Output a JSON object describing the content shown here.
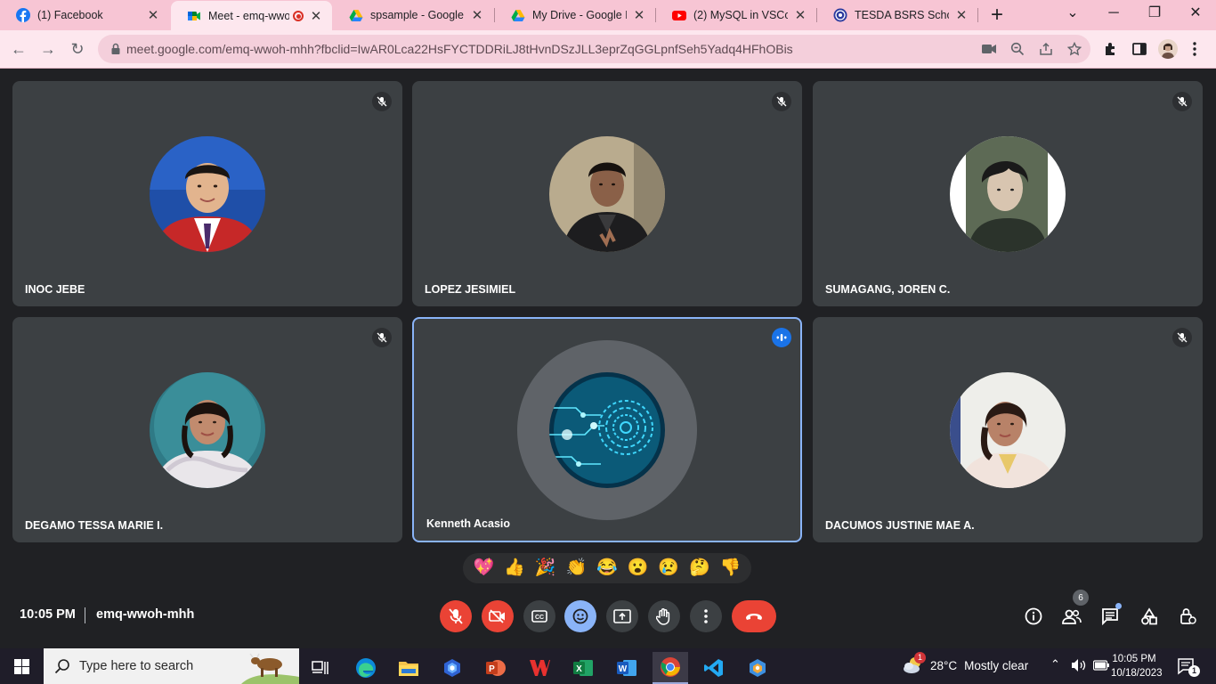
{
  "browser": {
    "tabs": [
      {
        "title": "(1) Facebook",
        "icon": "facebook-icon"
      },
      {
        "title": "Meet - emq-wwoh",
        "icon": "google-meet-icon",
        "active": true
      },
      {
        "title": "spsample - Google D",
        "icon": "google-drive-icon"
      },
      {
        "title": "My Drive - Google Dr",
        "icon": "google-drive-icon"
      },
      {
        "title": "(2) MySQL in VSCode",
        "icon": "youtube-icon"
      },
      {
        "title": "TESDA BSRS Scholar",
        "icon": "tesda-icon"
      }
    ],
    "new_tab": "+",
    "url": "meet.google.com/emq-wwoh-mhh?fbclid=IwAR0Lca22HsFYCTDDRiLJ8tHvnDSzJLL3eprZqGGLpnfSeh5Yadq4HFhOBis"
  },
  "meet": {
    "participants": [
      {
        "name": "INOC JEBE",
        "muted": true
      },
      {
        "name": "LOPEZ JESIMIEL",
        "muted": true
      },
      {
        "name": "SUMAGANG, JOREN C.",
        "muted": true
      },
      {
        "name": "DEGAMO TESSA MARIE I.",
        "muted": true
      },
      {
        "name": "Kenneth Acasio",
        "speaking": true
      },
      {
        "name": "DACUMOS JUSTINE MAE A.",
        "muted": true
      }
    ],
    "reactions": [
      "💖",
      "👍",
      "🎉",
      "👏",
      "😂",
      "😮",
      "😢",
      "🤔",
      "👎"
    ],
    "time": "10:05 PM",
    "separator": "|",
    "meeting_code": "emq-wwoh-mhh",
    "people_count": "6",
    "colors": {
      "tile": "#3c4043",
      "danger": "#ea4335",
      "accent": "#8ab4f8"
    }
  },
  "taskbar": {
    "search_placeholder": "Type here to search",
    "weather_temp": "28°C",
    "weather_text": "Mostly clear",
    "weather_badge": "1",
    "time": "10:05 PM",
    "date": "10/18/2023",
    "notification_count": "1"
  }
}
